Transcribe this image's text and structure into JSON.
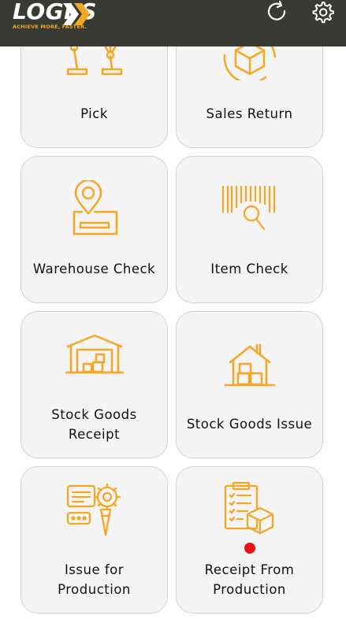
{
  "header": {
    "logo_text": "LOGI  S",
    "tagline": "ACHIEVE MORE, FASTER.",
    "refresh_icon": "refresh-icon",
    "settings_icon": "gear-icon",
    "background": "#3a3a34"
  },
  "colors": {
    "accent": "#f5a623",
    "card_bg": "#f4f4f4",
    "badge": "#e8141c"
  },
  "tiles": [
    {
      "label": "Pick",
      "icon": "robot-arm-icon"
    },
    {
      "label": "Sales Return",
      "icon": "box-return-icon"
    },
    {
      "label": "Warehouse Check",
      "icon": "location-pin-icon"
    },
    {
      "label": "Item Check",
      "icon": "barcode-search-icon"
    },
    {
      "label": "Stock Goods Receipt",
      "label_lines": [
        "Stock Goods",
        "Receipt"
      ],
      "icon": "warehouse-icon"
    },
    {
      "label": "Stock Goods Issue",
      "icon": "warehouse-boxes-icon"
    },
    {
      "label": "Issue for Production",
      "label_lines": [
        "Issue for",
        "Production"
      ],
      "icon": "production-gear-icon"
    },
    {
      "label": "Receipt From Production",
      "label_lines": [
        "Receipt From",
        "Production"
      ],
      "icon": "clipboard-box-icon",
      "has_notification": true
    }
  ]
}
